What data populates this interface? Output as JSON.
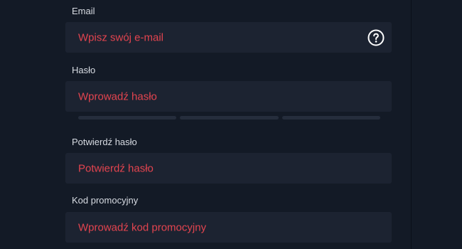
{
  "form": {
    "email": {
      "label": "Email",
      "placeholder": "Wpisz swój e-mail",
      "help_icon": "question-circle-icon"
    },
    "password": {
      "label": "Hasło",
      "placeholder": "Wprowadź hasło",
      "strength_segments": 3,
      "strength_filled": 0
    },
    "confirm_password": {
      "label": "Potwierdź hasło",
      "placeholder": "Potwierdź hasło"
    },
    "promo_code": {
      "label": "Kod promocyjny",
      "placeholder": "Wprowadź kod promocyjny"
    }
  },
  "colors": {
    "background": "#131a26",
    "field": "#1c2331",
    "placeholder": "#e3444f",
    "label": "#d7dbe2",
    "strength_empty": "#252d3c"
  }
}
